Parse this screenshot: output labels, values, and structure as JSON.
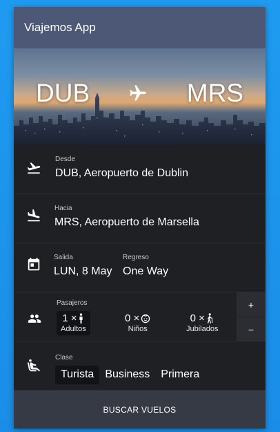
{
  "appbar": {
    "title": "Viajemos App"
  },
  "hero": {
    "from_code": "DUB",
    "to_code": "MRS",
    "plane_icon": "airplane-icon"
  },
  "desde": {
    "label": "Desde",
    "value": "DUB, Aeropuerto de Dublin",
    "icon": "flight-takeoff-icon"
  },
  "hacia": {
    "label": "Hacia",
    "value": "MRS, Aeropuerto de Marsella",
    "icon": "flight-land-icon"
  },
  "fechas": {
    "icon": "calendar-icon",
    "salida": {
      "label": "Salida",
      "value": "LUN, 8 May"
    },
    "regreso": {
      "label": "Regreso",
      "value": "One Way"
    }
  },
  "pasajeros": {
    "label": "Pasajeros",
    "icon": "people-icon",
    "items": [
      {
        "count": "1 ×",
        "name": "Adultos",
        "icon": "person-icon",
        "selected": true
      },
      {
        "count": "0 ×",
        "name": "Niños",
        "icon": "child-face-icon",
        "selected": false
      },
      {
        "count": "0 ×",
        "name": "Jubilados",
        "icon": "elderly-icon",
        "selected": false
      }
    ],
    "plus": "+",
    "minus": "−"
  },
  "clase": {
    "label": "Clase",
    "icon": "airline-seat-icon",
    "options": [
      "Turista",
      "Business",
      "Primera"
    ],
    "selected": "Turista"
  },
  "search_button": "BUSCAR VUELOS",
  "colors": {
    "appbar": "#4d5876",
    "panel": "#1f2024",
    "search": "#363a44",
    "background": "#1e9bf0"
  }
}
